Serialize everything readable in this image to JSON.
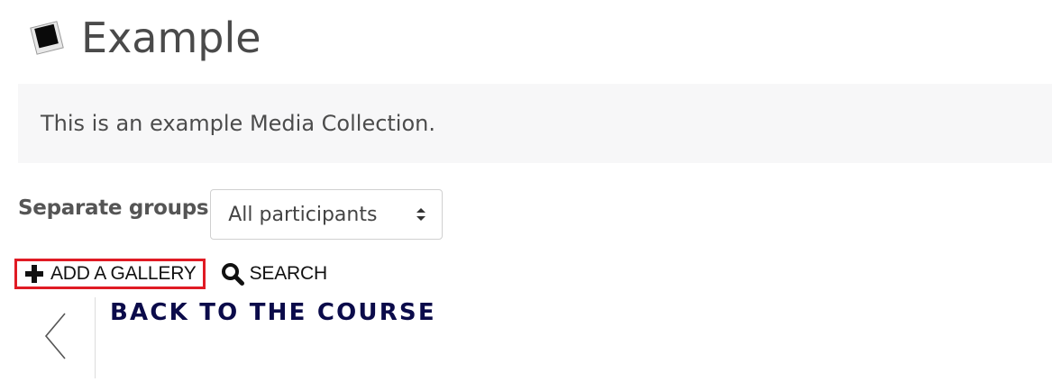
{
  "header": {
    "icon": "mediacollection-icon",
    "title": "Example"
  },
  "description": {
    "text": "This is an example Media Collection."
  },
  "groups": {
    "label": "Separate groups",
    "selected": "All participants",
    "icon": "updown-arrow-icon"
  },
  "actions": {
    "add_gallery_label": "ADD A GALLERY",
    "search_label": "SEARCH",
    "highlight_color": "#e01b24"
  },
  "back": {
    "label": "BACK TO THE COURSE",
    "icon": "chevron-left-icon"
  }
}
